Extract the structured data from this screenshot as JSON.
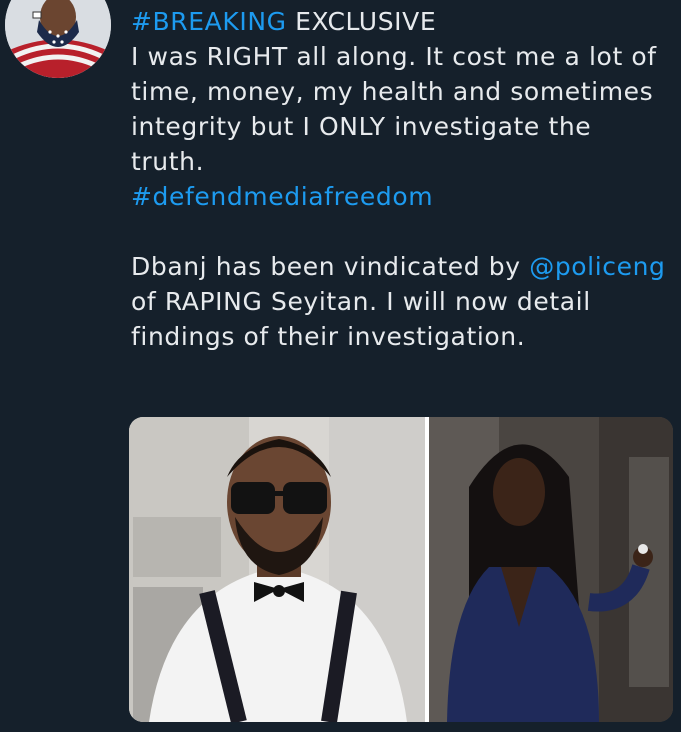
{
  "tweet": {
    "lines": [
      {
        "hashtag": "#BREAKING",
        "text": " EXCLUSIVE"
      },
      {
        "text": "I was RIGHT all along. It cost me a lot of"
      },
      {
        "text": "time, money, my health and sometimes"
      },
      {
        "text": "integrity but I ONLY investigate the"
      },
      {
        "text": "truth."
      }
    ],
    "hashtag2": "#defendmediafreedom",
    "para2_before": "Dbanj has been vindicated by ",
    "mention": "@policeng",
    "para2_line2": "of RAPING Seyitan. I will now detail",
    "para2_line3": "findings of their investigation."
  },
  "colors": {
    "background": "#15202b",
    "text": "#e7eaed",
    "link": "#1d9bf0"
  }
}
